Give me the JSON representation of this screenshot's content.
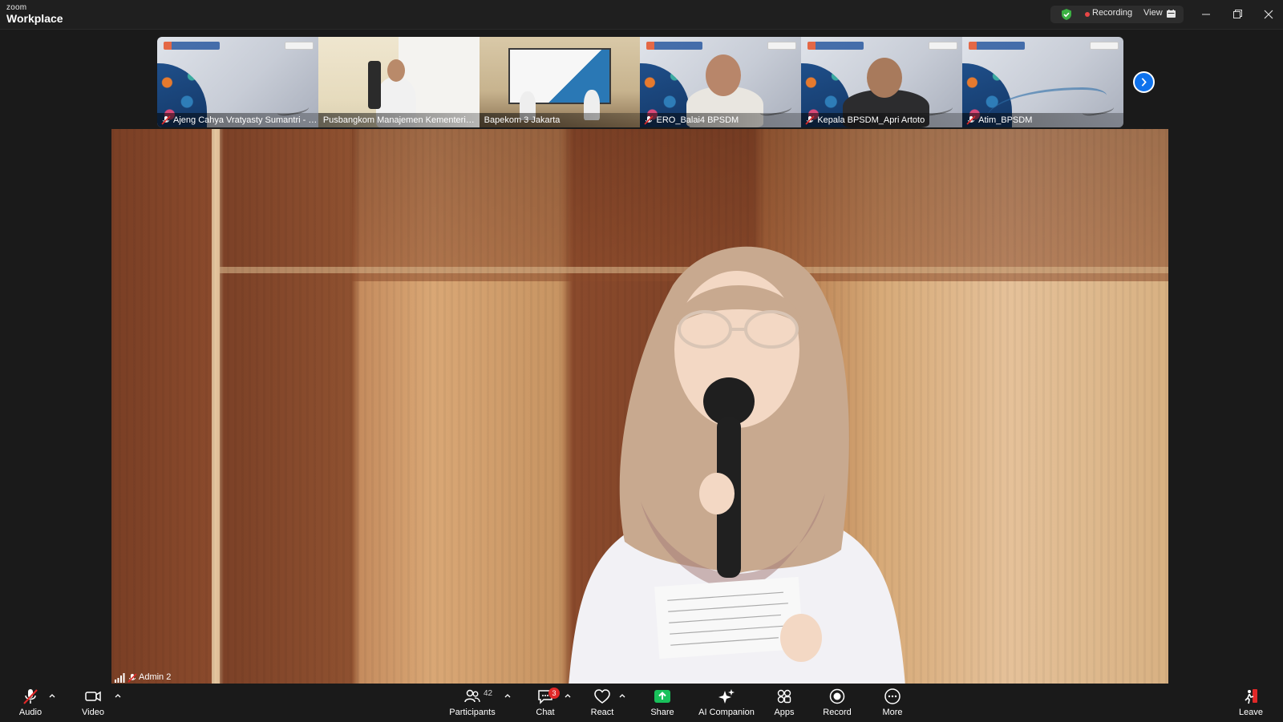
{
  "app": {
    "brand_small": "zoom",
    "brand_large": "Workplace"
  },
  "titlebar": {
    "recording_label": "Recording",
    "view_label": "View",
    "colors": {
      "recording_dot": "#e84646",
      "shield": "#3cb043"
    }
  },
  "thumbnails": [
    {
      "name": "Ajeng Cahya Vratyasty Sumantri - HP",
      "muted": true,
      "scene": "slide"
    },
    {
      "name": "Pusbangkom Manajemen Kementerian...",
      "muted": false,
      "scene": "office"
    },
    {
      "name": "Bapekom 3 Jakarta",
      "muted": false,
      "scene": "hall"
    },
    {
      "name": "ERO_Balai4 BPSDM",
      "muted": true,
      "scene": "slide"
    },
    {
      "name": "Kepala BPSDM_Apri Artoto",
      "muted": true,
      "scene": "slide"
    },
    {
      "name": "Atim_BPSDM",
      "muted": true,
      "scene": "slide"
    }
  ],
  "main_video": {
    "participant_name": "Admin 2",
    "muted": true
  },
  "toolbar": {
    "audio_label": "Audio",
    "video_label": "Video",
    "participants_label": "Participants",
    "participants_count": "42",
    "chat_label": "Chat",
    "chat_badge": "3",
    "react_label": "React",
    "share_label": "Share",
    "ai_label": "AI Companion",
    "apps_label": "Apps",
    "record_label": "Record",
    "more_label": "More",
    "leave_label": "Leave",
    "colors": {
      "share": "#19c15b",
      "leave": "#e02828",
      "accent": "#0e72ed"
    }
  }
}
